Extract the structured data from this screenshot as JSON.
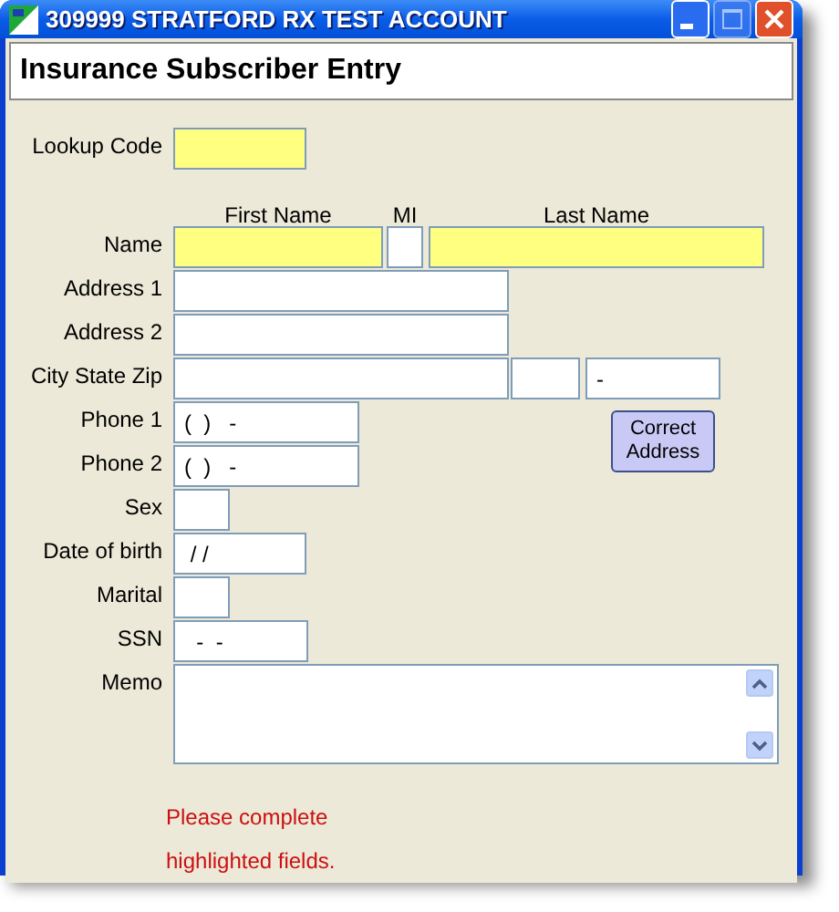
{
  "window": {
    "title": "309999 STRATFORD RX TEST ACCOUNT"
  },
  "header": "Insurance Subscriber Entry",
  "rows": [
    {
      "label": "Lookup Code",
      "inputs": [
        {
          "kind": "lookup",
          "highlighted": true
        }
      ]
    },
    {
      "label": "Name",
      "inputs": [
        {
          "kind": "first",
          "heading": "First Name",
          "highlighted": true
        },
        {
          "kind": "mi",
          "heading": "MI",
          "highlighted": false
        },
        {
          "kind": "last",
          "heading": "Last Name",
          "highlighted": true
        }
      ]
    },
    {
      "label": "Address 1",
      "inputs": [
        {
          "kind": "address",
          "highlighted": false
        }
      ]
    },
    {
      "label": "Address 2",
      "inputs": [
        {
          "kind": "address",
          "highlighted": false
        }
      ]
    },
    {
      "label": "City State Zip",
      "inputs": [
        {
          "kind": "city",
          "highlighted": false
        },
        {
          "kind": "state",
          "highlighted": false
        },
        {
          "kind": "zip",
          "value": "-",
          "highlighted": false
        }
      ]
    },
    {
      "label": "Phone 1",
      "inputs": [
        {
          "kind": "phone",
          "value": "(  )   -",
          "highlighted": false
        }
      ],
      "button": {
        "label": "Correct Address"
      }
    },
    {
      "label": "Phone 2",
      "inputs": [
        {
          "kind": "phone",
          "value": "(  )   -",
          "highlighted": false
        }
      ]
    },
    {
      "label": "Sex",
      "inputs": [
        {
          "kind": "short",
          "highlighted": false
        }
      ]
    },
    {
      "label": "Date of birth",
      "inputs": [
        {
          "kind": "date",
          "value": " / /",
          "highlighted": false
        }
      ]
    },
    {
      "label": "Marital",
      "inputs": [
        {
          "kind": "short",
          "highlighted": false
        }
      ]
    },
    {
      "label": "SSN",
      "inputs": [
        {
          "kind": "ssn",
          "value": "  -  -",
          "highlighted": false
        }
      ]
    },
    {
      "label": "Memo",
      "inputs": [
        {
          "kind": "memo",
          "highlighted": false
        }
      ]
    }
  ],
  "message": "Please complete highlighted fields."
}
